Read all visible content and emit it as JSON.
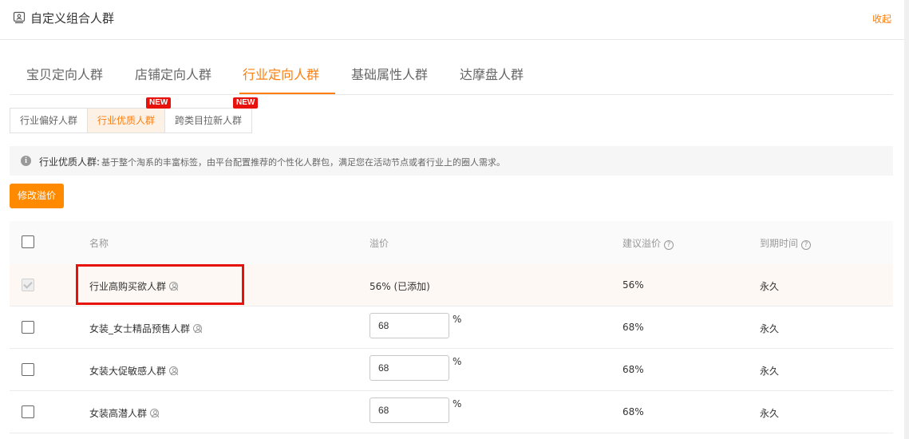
{
  "header": {
    "title": "自定义组合人群",
    "collapse_label": "收起"
  },
  "tabs": [
    {
      "label": "宝贝定向人群",
      "active": false
    },
    {
      "label": "店铺定向人群",
      "active": false
    },
    {
      "label": "行业定向人群",
      "active": true
    },
    {
      "label": "基础属性人群",
      "active": false
    },
    {
      "label": "达摩盘人群",
      "active": false
    }
  ],
  "subtabs": [
    {
      "label": "行业偏好人群",
      "active": false,
      "badge": ""
    },
    {
      "label": "行业优质人群",
      "active": true,
      "badge": "NEW"
    },
    {
      "label": "跨类目拉新人群",
      "active": false,
      "badge": "NEW"
    }
  ],
  "info": {
    "label": "行业优质人群:",
    "text": "基于整个淘系的丰富标签，由平台配置推荐的个性化人群包，满足您在活动节点或者行业上的圈人需求。"
  },
  "toolbar": {
    "modify_label": "修改溢价"
  },
  "table": {
    "columns": {
      "name": "名称",
      "premium": "溢价",
      "suggested": "建议溢价",
      "expire": "到期时间"
    },
    "rows": [
      {
        "name": "行业高购买欲人群",
        "premium_text": "56% (已添加)",
        "premium_value": "",
        "suggested": "56%",
        "expire": "永久",
        "added": true
      },
      {
        "name": "女装_女士精品预售人群",
        "premium_text": "",
        "premium_value": "68",
        "suggested": "68%",
        "expire": "永久",
        "added": false
      },
      {
        "name": "女装大促敏感人群",
        "premium_text": "",
        "premium_value": "68",
        "suggested": "68%",
        "expire": "永久",
        "added": false
      },
      {
        "name": "女装高潜人群",
        "premium_text": "",
        "premium_value": "68",
        "suggested": "68%",
        "expire": "永久",
        "added": false
      }
    ],
    "percent_sign": "%"
  },
  "colors": {
    "accent": "#ff7d0a",
    "button": "#ff8a00",
    "badge": "#e8120c",
    "highlight_box": "#e8120c"
  }
}
